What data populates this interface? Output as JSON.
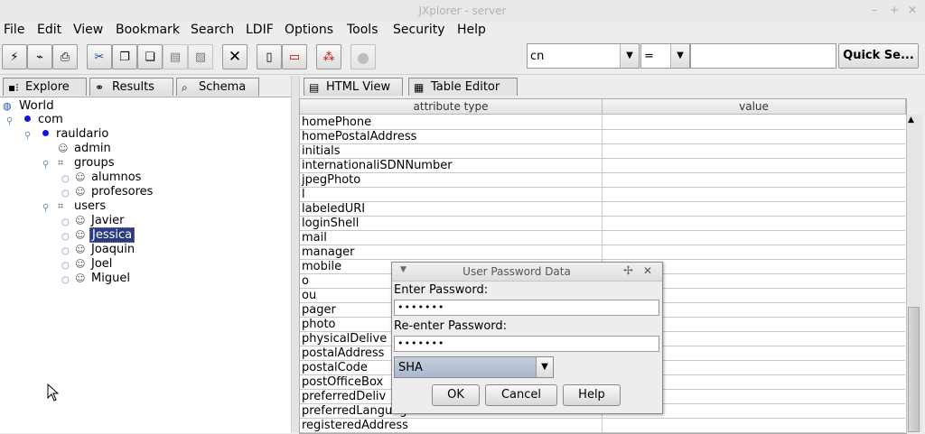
{
  "window": {
    "title": "JXplorer - server",
    "controls": [
      "–",
      "+",
      "✕"
    ]
  },
  "menubar": [
    {
      "label": "File"
    },
    {
      "label": "Edit"
    },
    {
      "label": "View"
    },
    {
      "label": "Bookmark"
    },
    {
      "label": "Search"
    },
    {
      "label": "LDIF"
    },
    {
      "label": "Options"
    },
    {
      "label": "Tools"
    },
    {
      "label": "Security"
    },
    {
      "label": "Help"
    }
  ],
  "toolbar": {
    "attribute_combo": "cn",
    "operator_combo": "=",
    "search_value": "",
    "quick_search_label": "Quick Se..."
  },
  "left_tabs": [
    {
      "label": "Explore"
    },
    {
      "label": "Results"
    },
    {
      "label": "Schema"
    }
  ],
  "tree": {
    "root": "World",
    "com": "com",
    "org": "rauldario",
    "admin": "admin",
    "groups": "groups",
    "alumnos": "alumnos",
    "profesores": "profesores",
    "users": "users",
    "user_items": [
      "Javier",
      "Jessica",
      "Joaquin",
      "Joel",
      "Miguel"
    ],
    "selected": "Jessica"
  },
  "right_tabs": [
    {
      "label": "HTML View"
    },
    {
      "label": "Table Editor"
    }
  ],
  "table": {
    "headers": [
      "attribute type",
      "value"
    ],
    "rows": [
      "homePhone",
      "homePostalAddress",
      "initials",
      "internationaliSDNNumber",
      "jpegPhoto",
      "l",
      "labeledURI",
      "loginShell",
      "mail",
      "manager",
      "mobile",
      "o",
      "ou",
      "pager",
      "photo",
      "physicalDelive",
      "postalAddress",
      "postalCode",
      "postOfficeBox",
      "preferredDeliv",
      "preferredLanguage",
      "registeredAddress"
    ]
  },
  "dialog": {
    "title": "User Password Data",
    "enter_label": "Enter Password:",
    "enter_value": "•••••••",
    "reenter_label": "Re-enter Password:",
    "reenter_value": "•••••••",
    "algorithm": "SHA",
    "ok_label": "OK",
    "cancel_label": "Cancel",
    "help_label": "Help"
  }
}
